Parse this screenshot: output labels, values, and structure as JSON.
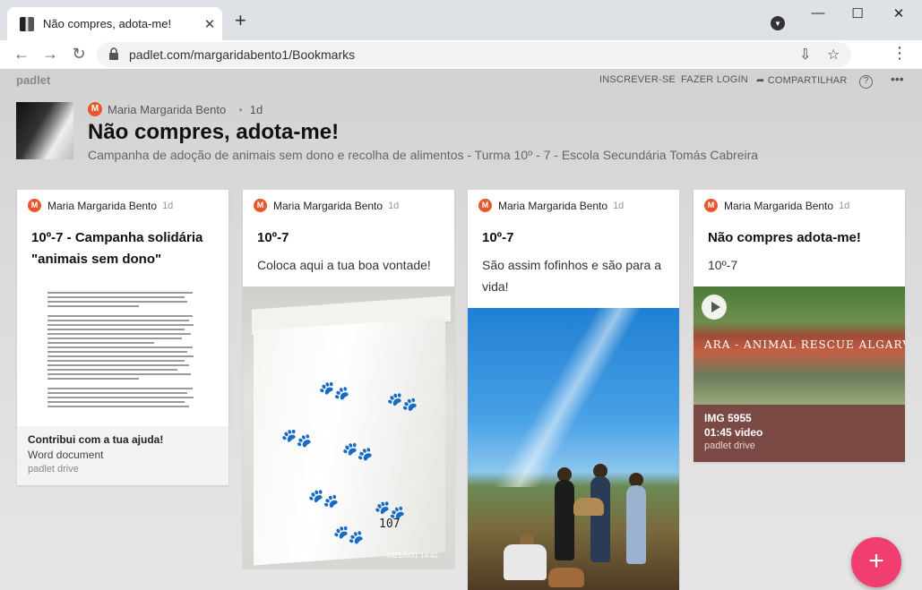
{
  "browser": {
    "tab_title": "Não compres, adota-me!",
    "tab_close": "✕",
    "new_tab": "+",
    "url": "padlet.com/margaridabento1/Bookmarks",
    "window_controls": {
      "minimize": "—",
      "maximize": "☐",
      "close": "✕"
    }
  },
  "padlet": {
    "logo": "padlet",
    "top_links": {
      "subscribe": "INSCREVER-SE",
      "login": "FAZER LOGIN",
      "share": "COMPARTILHAR"
    },
    "help": "?",
    "more": "•••",
    "board": {
      "author_initial": "M",
      "author": "Maria Margarida Bento",
      "time": "1d",
      "title": "Não compres, adota-me!",
      "description": "Campanha de adoção de animais sem dono e recolha de alimentos - Turma 10º - 7 - Escola Secundária Tomás Cabreira"
    },
    "cards": [
      {
        "author_initial": "M",
        "author": "Maria Margarida Bento",
        "time": "1d",
        "title": "10º-7 - Campanha solidária \"animais sem dono\"",
        "attachment": {
          "title": "Contribui com a tua ajuda!",
          "type": "Word document",
          "source": "padlet drive"
        }
      },
      {
        "author_initial": "M",
        "author": "Maria Margarida Bento",
        "time": "1d",
        "title": "10º-7",
        "body": "Coloca aqui a tua boa vontade!",
        "photo_number": "107",
        "photo_stamp": "2021/5/31  14:42"
      },
      {
        "author_initial": "M",
        "author": "Maria Margarida Bento",
        "time": "1d",
        "title": "10º-7",
        "body": "São assim fofinhos e são para a vida!"
      },
      {
        "author_initial": "M",
        "author": "Maria Margarida Bento",
        "time": "1d",
        "title": "Não compres adota-me!",
        "body": "10º-7",
        "video_sign": "ARA - ANIMAL RESCUE ALGARVE",
        "attachment": {
          "title": "IMG 5955",
          "meta": "01:45 video",
          "source": "padlet drive"
        }
      }
    ],
    "fab": "+"
  },
  "colors": {
    "accent": "#ef3e6f",
    "avatar": "#e8562a",
    "video_footer": "#7b4944"
  }
}
